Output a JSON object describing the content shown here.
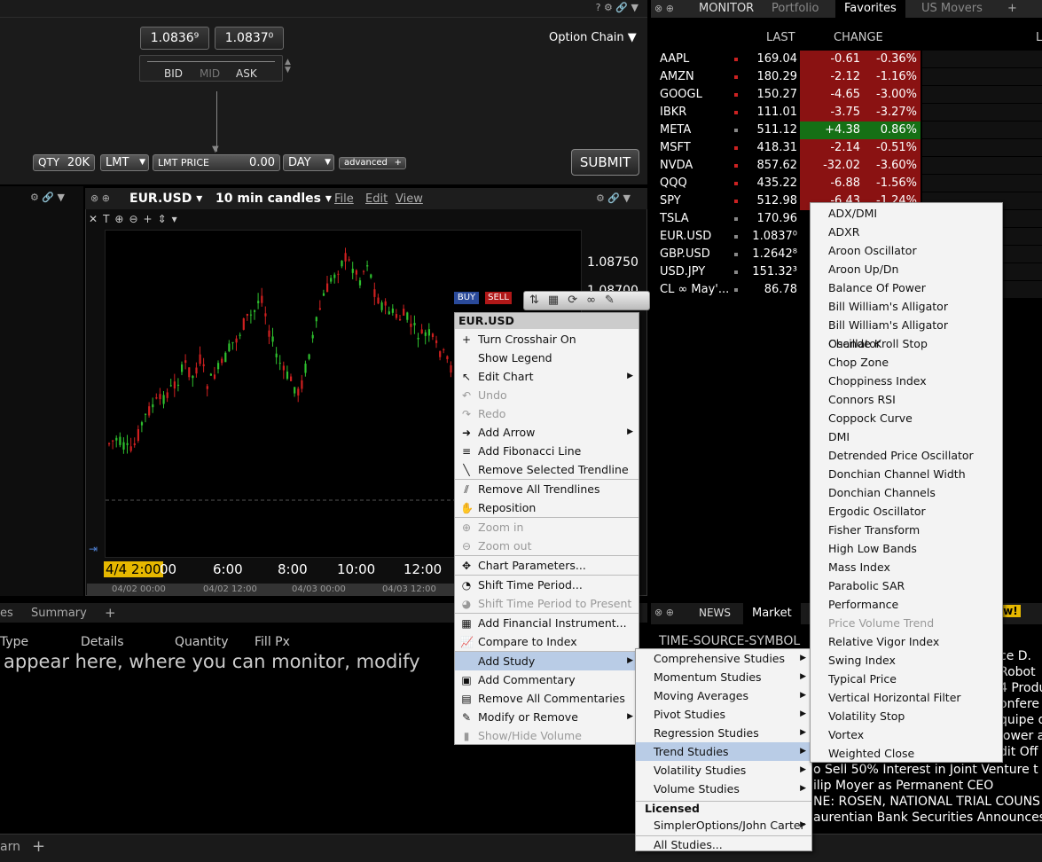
{
  "order_entry": {
    "top_icons": "? ⚙ 🔗 ▼",
    "bid_price": "1.0836⁹",
    "ask_price": "1.0837⁰",
    "bid_label": "BID",
    "mid_label": "MID",
    "ask_label": "ASK",
    "option_chain": "Option Chain",
    "qty_label": "QTY",
    "qty_value": "20K",
    "order_type": "LMT",
    "lmt_price_label": "LMT PRICE",
    "lmt_price_value": "0.00",
    "tif": "DAY",
    "advanced": "advanced",
    "submit": "SUBMIT"
  },
  "monitor": {
    "label": "MONITOR",
    "tabs": [
      "Portfolio",
      "Favorites",
      "US Movers"
    ],
    "active_tab": "Favorites",
    "add_tab": "+",
    "col_last": "LAST",
    "col_change": "CHANGE",
    "col_extra": "L",
    "rows": [
      {
        "sym": "AAPL",
        "last": "169.04",
        "chg": "-0.61",
        "pct": "-0.36%",
        "dir": "down"
      },
      {
        "sym": "AMZN",
        "last": "180.29",
        "chg": "-2.12",
        "pct": "-1.16%",
        "dir": "down"
      },
      {
        "sym": "GOOGL",
        "last": "150.27",
        "chg": "-4.65",
        "pct": "-3.00%",
        "dir": "down"
      },
      {
        "sym": "IBKR",
        "last": "111.01",
        "chg": "-3.75",
        "pct": "-3.27%",
        "dir": "down"
      },
      {
        "sym": "META",
        "last": "511.12",
        "chg": "+4.38",
        "pct": "0.86%",
        "dir": "up"
      },
      {
        "sym": "MSFT",
        "last": "418.31",
        "chg": "-2.14",
        "pct": "-0.51%",
        "dir": "down"
      },
      {
        "sym": "NVDA",
        "last": "857.62",
        "chg": "-32.02",
        "pct": "-3.60%",
        "dir": "down"
      },
      {
        "sym": "QQQ",
        "last": "435.22",
        "chg": "-6.88",
        "pct": "-1.56%",
        "dir": "down"
      },
      {
        "sym": "SPY",
        "last": "512.98",
        "chg": "-6.43",
        "pct": "-1.24%",
        "dir": "down"
      },
      {
        "sym": "TSLA",
        "last": "170.96",
        "chg": "",
        "pct": "",
        "dir": "none"
      },
      {
        "sym": "EUR.USD",
        "last": "1.0837⁰",
        "chg": "",
        "pct": "",
        "dir": "none"
      },
      {
        "sym": "GBP.USD",
        "last": "1.2642⁸",
        "chg": "",
        "pct": "",
        "dir": "none"
      },
      {
        "sym": "USD.JPY",
        "last": "151.32³",
        "chg": "",
        "pct": "",
        "dir": "none"
      },
      {
        "sym": "CL ∞ May'...",
        "last": "86.78",
        "chg": "",
        "pct": "",
        "dir": "none"
      }
    ]
  },
  "chart": {
    "symbol": "EUR.USD",
    "interval": "10 min candles",
    "menu_file": "File",
    "menu_edit": "Edit",
    "menu_view": "View",
    "price_labels": [
      "1.08750",
      "1.08700"
    ],
    "x_labels": [
      "4/4 2:00",
      "00",
      "6:00",
      "8:00",
      "10:00",
      "12:00"
    ],
    "x_sublabels": [
      "04/02 00:00",
      "04/02 12:00",
      "04/03 00:00",
      "04/03 12:00"
    ],
    "buy": "BUY",
    "sell": "SELL"
  },
  "orders_panel": {
    "tab_partial": "es",
    "tab_summary": "Summary",
    "add": "+",
    "col_type": "Type",
    "col_details": "Details",
    "col_quantity": "Quantity",
    "col_fillpx": "Fill Px",
    "message": "appear here, where you can monitor, modify"
  },
  "news": {
    "label": "NEWS",
    "tab_market": "Market",
    "badge": "ew!",
    "header": "TIME-SOURCE-SYMBOL",
    "right_lines": [
      "ce D.",
      "Robot",
      "4 Produ",
      "onfere",
      "quipe d",
      "lower a",
      "dit Off"
    ],
    "headlines": [
      "o Sell 50% Interest in Joint Venture t",
      "ilip Moyer as Permanent CEO",
      "NE: ROSEN, NATIONAL TRIAL COUNS",
      "aurentian Bank Securities Announces"
    ]
  },
  "bottom_bar": {
    "tab_partial": "arn",
    "add": "+"
  },
  "context_menu": {
    "title": "EUR.USD",
    "items": [
      {
        "label": "Turn Crosshair On",
        "icon": "+",
        "dis": false,
        "sub": false
      },
      {
        "label": "Show Legend",
        "icon": "",
        "dis": false,
        "sub": false
      },
      {
        "label": "Edit Chart",
        "icon": "↖",
        "dis": false,
        "sub": true
      },
      {
        "label": "Undo",
        "icon": "↶",
        "dis": true,
        "sub": false
      },
      {
        "label": "Redo",
        "icon": "↷",
        "dis": true,
        "sub": false
      },
      {
        "label": "Add Arrow",
        "icon": "➜",
        "dis": false,
        "sub": true
      },
      {
        "label": "Add Fibonacci Line",
        "icon": "≡",
        "dis": false,
        "sub": false
      },
      {
        "label": "Remove Selected Trendline",
        "icon": "╲",
        "dis": false,
        "sub": false
      },
      {
        "label": "Remove All Trendlines",
        "icon": "⫽",
        "dis": false,
        "sub": false
      },
      {
        "label": "Reposition",
        "icon": "✋",
        "dis": false,
        "sub": false
      },
      {
        "label": "Zoom in",
        "icon": "⊕",
        "dis": true,
        "sub": false
      },
      {
        "label": "Zoom out",
        "icon": "⊖",
        "dis": true,
        "sub": false
      },
      {
        "label": "Chart Parameters...",
        "icon": "✥",
        "dis": false,
        "sub": false
      },
      {
        "label": "Shift Time Period...",
        "icon": "◔",
        "dis": false,
        "sub": false
      },
      {
        "label": "Shift Time Period to Present",
        "icon": "◕",
        "dis": true,
        "sub": false
      },
      {
        "label": "Add Financial Instrument...",
        "icon": "▦",
        "dis": false,
        "sub": false
      },
      {
        "label": "Compare to Index",
        "icon": "📈",
        "dis": false,
        "sub": false
      },
      {
        "label": "Add Study",
        "icon": "",
        "dis": false,
        "sub": true,
        "sel": true
      },
      {
        "label": "Add Commentary",
        "icon": "▣",
        "dis": false,
        "sub": false
      },
      {
        "label": "Remove All Commentaries",
        "icon": "▤",
        "dis": false,
        "sub": false
      },
      {
        "label": "Modify or Remove",
        "icon": "✎",
        "dis": false,
        "sub": true
      },
      {
        "label": "Show/Hide Volume",
        "icon": "▮",
        "dis": true,
        "sub": false
      }
    ]
  },
  "study_menu": {
    "items": [
      "Comprehensive Studies",
      "Momentum Studies",
      "Moving Averages",
      "Pivot Studies",
      "Regression Studies",
      "Trend Studies",
      "Volatility Studies",
      "Volume Studies"
    ],
    "selected": "Trend Studies",
    "licensed_header": "Licensed",
    "licensed_items": [
      "SimplerOptions/John Carter"
    ],
    "all_studies": "All Studies..."
  },
  "trend_menu": {
    "items": [
      "ADX/DMI",
      "ADXR",
      "Aroon Oscillator",
      "Aroon Up/Dn",
      "Balance Of Power",
      "Bill William's Alligator",
      "Bill William's Alligator Oscillator",
      "Chande Kroll Stop",
      "Chop Zone",
      "Choppiness Index",
      "Connors RSI",
      "Coppock Curve",
      "DMI",
      "Detrended Price Oscillator",
      "Donchian Channel Width",
      "Donchian Channels",
      "Ergodic Oscillator",
      "Fisher Transform",
      "High Low Bands",
      "Mass Index",
      "Parabolic SAR",
      "Performance",
      "Price Volume Trend",
      "Relative Vigor Index",
      "Swing Index",
      "Typical Price",
      "Vertical Horizontal Filter",
      "Volatility Stop",
      "Vortex",
      "Weighted Close"
    ],
    "disabled": [
      "Price Volume Trend"
    ]
  },
  "colors": {
    "down": "#8a1212",
    "up": "#157015",
    "menu_sel": "#b9cce6"
  }
}
